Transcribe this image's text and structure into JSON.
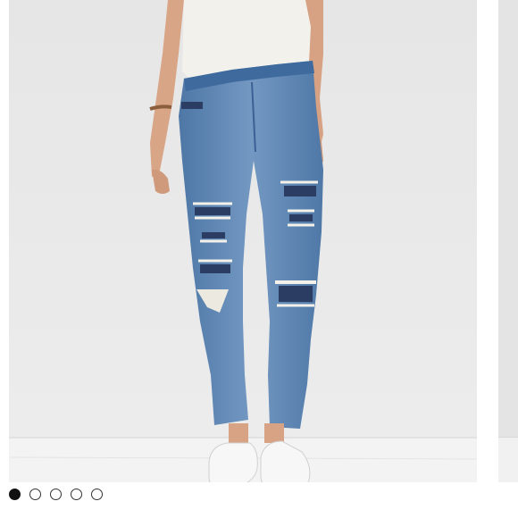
{
  "carousel": {
    "slide_count": 5,
    "active_index": 0,
    "main_image_alt": "",
    "colors": {
      "wall": "#e9e9e9",
      "floor": "#f3f3f3",
      "denim": "#5f86b2",
      "denim_dark": "#2d3f66",
      "shirt": "#f2f1ec",
      "skin": "#d7a384",
      "shoes": "#f7f7f7"
    }
  }
}
